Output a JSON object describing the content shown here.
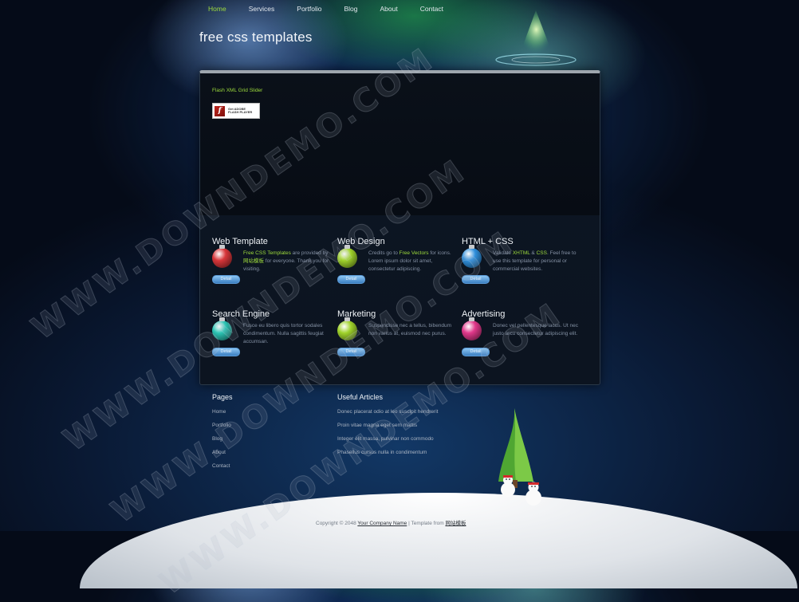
{
  "nav": {
    "items": [
      {
        "label": "Home",
        "active": true
      },
      {
        "label": "Services",
        "active": false
      },
      {
        "label": "Portfolio",
        "active": false
      },
      {
        "label": "Blog",
        "active": false
      },
      {
        "label": "About",
        "active": false
      },
      {
        "label": "Contact",
        "active": false
      }
    ]
  },
  "header": {
    "title": "free css templates"
  },
  "slider": {
    "label": "Flash XML Grid Slider",
    "flash_badge": {
      "line1": "Get ADOBE",
      "line2": "FLASH PLAYER"
    }
  },
  "features": [
    {
      "title": "Web Template",
      "ball_color": "#d8363a",
      "prefix": "",
      "hl1": "Free CSS Templates",
      "mid": " are provided by ",
      "hl2": "网站模板",
      "suffix": " for everyone. Thank you for visiting.",
      "button": "Detail"
    },
    {
      "title": "Web Design",
      "ball_color": "#9fd22b",
      "prefix": "Credits go to ",
      "hl1": "Free Vectors",
      "mid": " for icons. Lorem ipsum dolor sit amet, consectetur adipiscing.",
      "hl2": "",
      "suffix": "",
      "button": "Detail"
    },
    {
      "title": "HTML + CSS",
      "ball_color": "#2f8fdc",
      "prefix": "Validate ",
      "hl1": "XHTML",
      "mid": " & ",
      "hl2": "CSS",
      "suffix": ". Feel free to use this template for personal or commercial websites.",
      "button": "Detail"
    },
    {
      "title": "Search Engine",
      "ball_color": "#2cc3b3",
      "prefix": "Fusce eu libero quis tortor sodales condimentum. Nulla sagittis feugiat accumsan.",
      "hl1": "",
      "mid": "",
      "hl2": "",
      "suffix": "",
      "button": "Detail"
    },
    {
      "title": "Marketing",
      "ball_color": "#9fd22b",
      "prefix": "Suspendisse nec a tellus, bibendum non varius at, euismod nec purus.",
      "hl1": "",
      "mid": "",
      "hl2": "",
      "suffix": "",
      "button": "Detail"
    },
    {
      "title": "Advertising",
      "ball_color": "#e0388a",
      "prefix": "Donec vel pellentesque lacus. Ut nec justo arcu consectetur adipiscing elit.",
      "hl1": "",
      "mid": "",
      "hl2": "",
      "suffix": "",
      "button": "Detail"
    }
  ],
  "footer": {
    "pages": {
      "heading": "Pages",
      "links": [
        "Home",
        "Portfolio",
        "Blog",
        "About",
        "Contact"
      ]
    },
    "articles": {
      "heading": "Useful Articles",
      "links": [
        "Donec placerat odio at leo suscipit hendrerit",
        "Proin vitae magna eget sem mattis",
        "Integer elit massa, pulvinar non commodo",
        "Phasellus cursus nulla in condimentum"
      ]
    }
  },
  "copyright": {
    "prefix": "Copyright © 2048 ",
    "company": "Your Company Name",
    "middle": " | Template from ",
    "source": "网站模板"
  },
  "watermark": {
    "text": "WWW.DOWNDEMO.COM"
  },
  "colors": {
    "accent": "#9ddb3c",
    "panel_border": "#9ea6ae"
  }
}
